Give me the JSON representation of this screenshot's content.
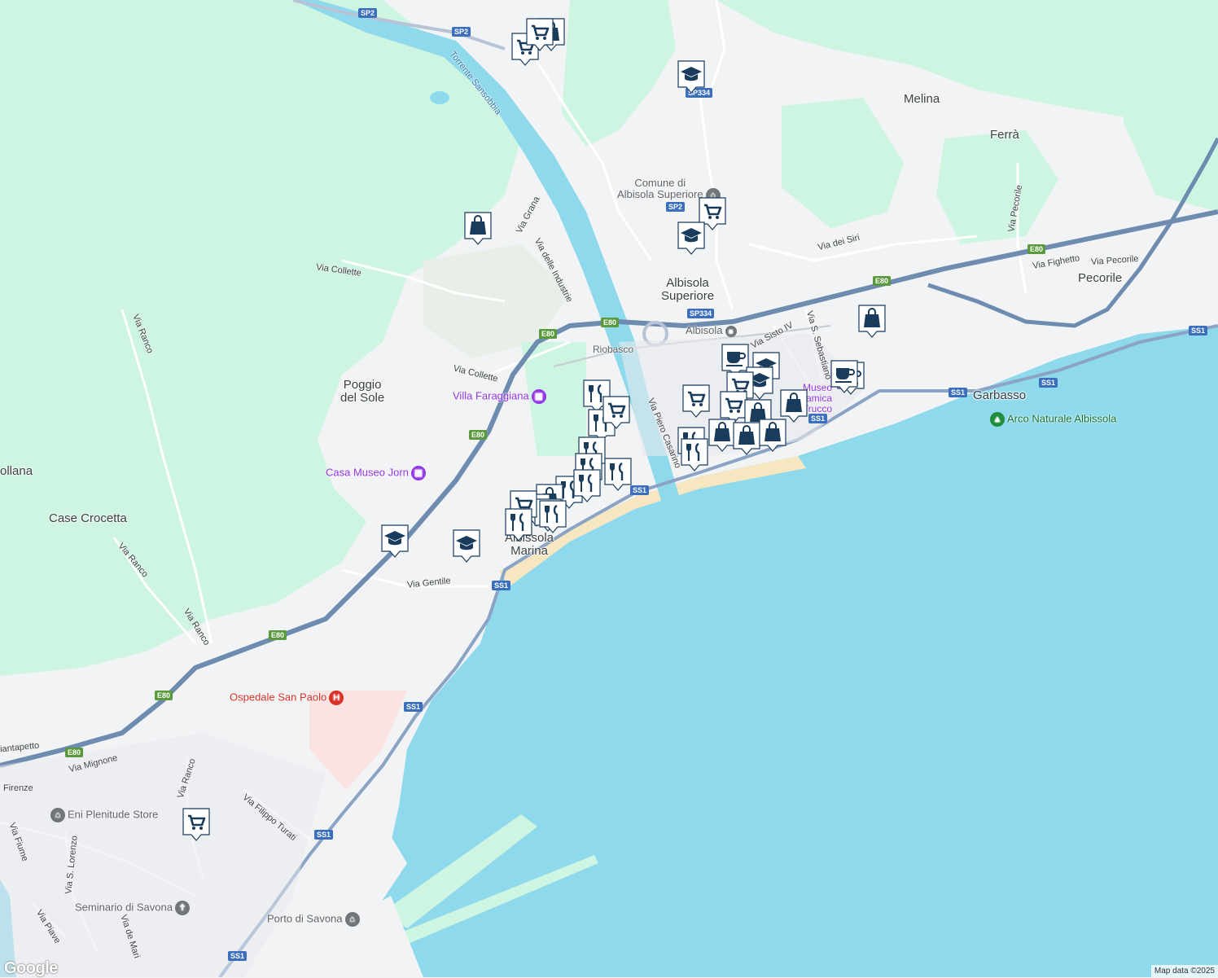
{
  "map": {
    "places": [
      {
        "id": "albisola-superiore",
        "text": "Albisola\nSuperiore"
      },
      {
        "id": "albissola-marina",
        "text": "Albissola\nMarina"
      },
      {
        "id": "poggio-del-sole",
        "text": "Poggio\ndel Sole"
      },
      {
        "id": "melina",
        "text": "Melina"
      },
      {
        "id": "ferra",
        "text": "Ferrà"
      },
      {
        "id": "pecorile",
        "text": "Pecorile"
      },
      {
        "id": "garbasso",
        "text": "Garbasso"
      },
      {
        "id": "case-crocetta",
        "text": "Case Crocetta"
      },
      {
        "id": "ollana",
        "text": "ollana"
      },
      {
        "id": "riobasco",
        "text": "Riobasco"
      }
    ],
    "streets": [
      {
        "id": "via-collette-1",
        "text": "Via Collette"
      },
      {
        "id": "via-collette-2",
        "text": "Via Collette"
      },
      {
        "id": "via-grana",
        "text": "Via Grana"
      },
      {
        "id": "via-delle-industrie",
        "text": "Via delle Industrie"
      },
      {
        "id": "torrente-sansobbia",
        "text": "Torrente Sansobbia"
      },
      {
        "id": "via-ranco-1",
        "text": "Via Ranco"
      },
      {
        "id": "via-ranco-2",
        "text": "Via Ranco"
      },
      {
        "id": "via-ranco-3",
        "text": "Via Ranco"
      },
      {
        "id": "via-ranco-4",
        "text": "Via Ranco"
      },
      {
        "id": "via-gentile",
        "text": "Via Gentile"
      },
      {
        "id": "via-piero-casarino",
        "text": "Via Piero Casarino"
      },
      {
        "id": "via-sisto-iv",
        "text": "Via Sisto IV"
      },
      {
        "id": "via-s-sebastiano",
        "text": "Via S. Sebastiano"
      },
      {
        "id": "via-dei-siri",
        "text": "Via dei Siri"
      },
      {
        "id": "via-pecorile-1",
        "text": "Via Pecorile"
      },
      {
        "id": "via-pecorile-2",
        "text": "Via Pecorile"
      },
      {
        "id": "via-fighetto",
        "text": "Via Fighetto"
      },
      {
        "id": "via-mignone",
        "text": "Via Mignone"
      },
      {
        "id": "giantapetto",
        "text": "iantapetto"
      },
      {
        "id": "firenze",
        "text": "Firenze"
      },
      {
        "id": "via-filippo-turati",
        "text": "Via Filippo Turati"
      },
      {
        "id": "via-fiume",
        "text": "Via Fiume"
      },
      {
        "id": "via-s-lorenzo",
        "text": "Via S. Lorenzo"
      },
      {
        "id": "via-piave",
        "text": "Via Piave"
      },
      {
        "id": "via-de-mari",
        "text": "Via de Mari"
      }
    ],
    "pois": [
      {
        "id": "comune-albisola",
        "text": "Comune di\nAlbisola Superiore",
        "color": "gray",
        "icon": "landmark-icon"
      },
      {
        "id": "albisola-station",
        "text": "Albisola",
        "color": "gray",
        "icon": "train-icon"
      },
      {
        "id": "villa-faraggiana",
        "text": "Villa Faraggiana",
        "color": "purple",
        "icon": "museum-icon"
      },
      {
        "id": "casa-museo-jorn",
        "text": "Casa Museo Jorn",
        "color": "purple",
        "icon": "museum-icon"
      },
      {
        "id": "ospedale-san-paolo",
        "text": "Ospedale San Paolo",
        "color": "red",
        "icon": "hospital-icon"
      },
      {
        "id": "arco-naturale",
        "text": "Arco Naturale Albissola",
        "color": "green",
        "icon": "tree-icon"
      },
      {
        "id": "eni-plenitude",
        "text": "Eni Plenitude Store",
        "color": "gray",
        "icon": "landmark-icon"
      },
      {
        "id": "seminario-savona",
        "text": "Seminario di Savona",
        "color": "gray",
        "icon": "church-icon"
      },
      {
        "id": "porto-savona",
        "text": "Porto di Savona",
        "color": "gray",
        "icon": "landmark-icon"
      },
      {
        "id": "museo-ceramica",
        "text": "Museo Ceramica Trucco",
        "color": "purple",
        "icon": "museum-icon"
      }
    ],
    "shields": [
      {
        "id": "sp2-a",
        "text": "SP2",
        "type": "blue"
      },
      {
        "id": "sp2-b",
        "text": "SP2",
        "type": "blue"
      },
      {
        "id": "sp2-c",
        "text": "SP2",
        "type": "blue"
      },
      {
        "id": "sp334-a",
        "text": "SP334",
        "type": "blue"
      },
      {
        "id": "sp334-b",
        "text": "SP334",
        "type": "blue"
      },
      {
        "id": "e80-a",
        "text": "E80",
        "type": "green"
      },
      {
        "id": "e80-b",
        "text": "E80",
        "type": "green"
      },
      {
        "id": "e80-c",
        "text": "E80",
        "type": "green"
      },
      {
        "id": "e80-d",
        "text": "E80",
        "type": "green"
      },
      {
        "id": "e80-e",
        "text": "E80",
        "type": "green"
      },
      {
        "id": "e80-f",
        "text": "E80",
        "type": "green"
      },
      {
        "id": "e80-g",
        "text": "E80",
        "type": "green"
      },
      {
        "id": "e80-h",
        "text": "E80",
        "type": "green"
      },
      {
        "id": "ss1-a",
        "text": "SS1",
        "type": "blue"
      },
      {
        "id": "ss1-b",
        "text": "SS1",
        "type": "blue"
      },
      {
        "id": "ss1-c",
        "text": "SS1",
        "type": "blue"
      },
      {
        "id": "ss1-d",
        "text": "SS1",
        "type": "blue"
      },
      {
        "id": "ss1-e",
        "text": "SS1",
        "type": "blue"
      },
      {
        "id": "ss1-f",
        "text": "SS1",
        "type": "blue"
      },
      {
        "id": "ss1-g",
        "text": "SS1",
        "type": "blue"
      },
      {
        "id": "ss1-h",
        "text": "SS1",
        "type": "blue"
      },
      {
        "id": "ss1-i",
        "text": "SS1",
        "type": "blue"
      }
    ],
    "markers": [
      {
        "type": "shopping-cart"
      },
      {
        "type": "shopping-bag"
      },
      {
        "type": "shopping-cart"
      },
      {
        "type": "school"
      },
      {
        "type": "shopping-cart"
      },
      {
        "type": "school"
      },
      {
        "type": "shopping-bag"
      },
      {
        "type": "shopping-bag"
      },
      {
        "type": "coffee"
      },
      {
        "type": "school"
      },
      {
        "type": "school"
      },
      {
        "type": "shopping-cart"
      },
      {
        "type": "shopping-cart"
      },
      {
        "type": "shopping-cart"
      },
      {
        "type": "shopping-bag"
      },
      {
        "type": "shopping-bag"
      },
      {
        "type": "shopping-bag"
      },
      {
        "type": "shopping-bag"
      },
      {
        "type": "shopping-bag"
      },
      {
        "type": "restaurant"
      },
      {
        "type": "coffee"
      },
      {
        "type": "coffee"
      },
      {
        "type": "restaurant"
      },
      {
        "type": "shopping-cart"
      },
      {
        "type": "restaurant"
      },
      {
        "type": "restaurant"
      },
      {
        "type": "restaurant"
      },
      {
        "type": "restaurant"
      },
      {
        "type": "restaurant"
      },
      {
        "type": "shopping-bag"
      },
      {
        "type": "restaurant"
      },
      {
        "type": "restaurant"
      },
      {
        "type": "restaurant"
      },
      {
        "type": "shopping-cart"
      },
      {
        "type": "restaurant"
      },
      {
        "type": "restaurant"
      },
      {
        "type": "restaurant"
      },
      {
        "type": "school"
      },
      {
        "type": "school"
      },
      {
        "type": "shopping-cart"
      }
    ],
    "colors": {
      "water": "#8fd9ed",
      "land": "#f1f3f4",
      "park": "#cdf5e1",
      "highway": "#6e8bb0",
      "road": "#ffffff",
      "marker_fill": "#1a3c5c",
      "marker_bg": "#ffffff"
    }
  },
  "attribution": "Map data ©2025",
  "logo": "Google"
}
